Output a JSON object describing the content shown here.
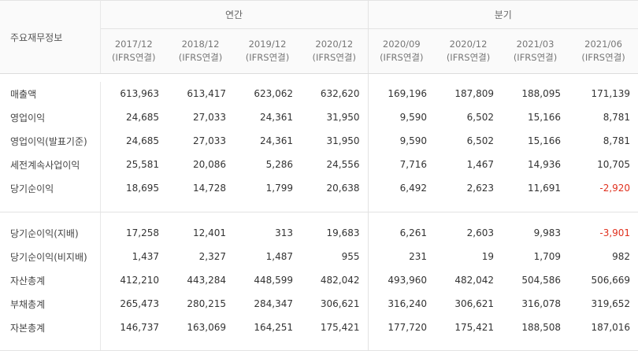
{
  "table": {
    "label_header": "주요재무정보",
    "groups": [
      {
        "label": "연간"
      },
      {
        "label": "분기"
      }
    ],
    "periods": [
      {
        "year": "2017/12",
        "standard": "(IFRS연결)"
      },
      {
        "year": "2018/12",
        "standard": "(IFRS연결)"
      },
      {
        "year": "2019/12",
        "standard": "(IFRS연결)"
      },
      {
        "year": "2020/12",
        "standard": "(IFRS연결)"
      },
      {
        "year": "2020/09",
        "standard": "(IFRS연결)"
      },
      {
        "year": "2020/12",
        "standard": "(IFRS연결)"
      },
      {
        "year": "2021/03",
        "standard": "(IFRS연결)"
      },
      {
        "year": "2021/06",
        "standard": "(IFRS연결)"
      }
    ],
    "rows_group1": [
      {
        "label": "매출액",
        "values": [
          "613,963",
          "613,417",
          "623,062",
          "632,620",
          "169,196",
          "187,809",
          "188,095",
          "171,139"
        ]
      },
      {
        "label": "영업이익",
        "values": [
          "24,685",
          "27,033",
          "24,361",
          "31,950",
          "9,590",
          "6,502",
          "15,166",
          "8,781"
        ]
      },
      {
        "label": "영업이익(발표기준)",
        "values": [
          "24,685",
          "27,033",
          "24,361",
          "31,950",
          "9,590",
          "6,502",
          "15,166",
          "8,781"
        ]
      },
      {
        "label": "세전계속사업이익",
        "values": [
          "25,581",
          "20,086",
          "5,286",
          "24,556",
          "7,716",
          "1,467",
          "14,936",
          "10,705"
        ]
      },
      {
        "label": "당기순이익",
        "values": [
          "18,695",
          "14,728",
          "1,799",
          "20,638",
          "6,492",
          "2,623",
          "11,691",
          "-2,920"
        ]
      }
    ],
    "rows_group2": [
      {
        "label": "당기순이익(지배)",
        "values": [
          "17,258",
          "12,401",
          "313",
          "19,683",
          "6,261",
          "2,603",
          "9,983",
          "-3,901"
        ]
      },
      {
        "label": "당기순이익(비지배)",
        "values": [
          "1,437",
          "2,327",
          "1,487",
          "955",
          "231",
          "19",
          "1,709",
          "982"
        ]
      },
      {
        "label": "자산총계",
        "values": [
          "412,210",
          "443,284",
          "448,599",
          "482,042",
          "493,960",
          "482,042",
          "504,586",
          "506,669"
        ]
      },
      {
        "label": "부채총계",
        "values": [
          "265,473",
          "280,215",
          "284,347",
          "306,621",
          "316,240",
          "306,621",
          "316,078",
          "319,652"
        ]
      },
      {
        "label": "자본총계",
        "values": [
          "146,737",
          "163,069",
          "164,251",
          "175,421",
          "177,720",
          "175,421",
          "188,508",
          "187,016"
        ]
      }
    ],
    "colors": {
      "negative": "#e0301e",
      "header_bg": "#fafafa",
      "border": "#e3e3e3"
    }
  }
}
